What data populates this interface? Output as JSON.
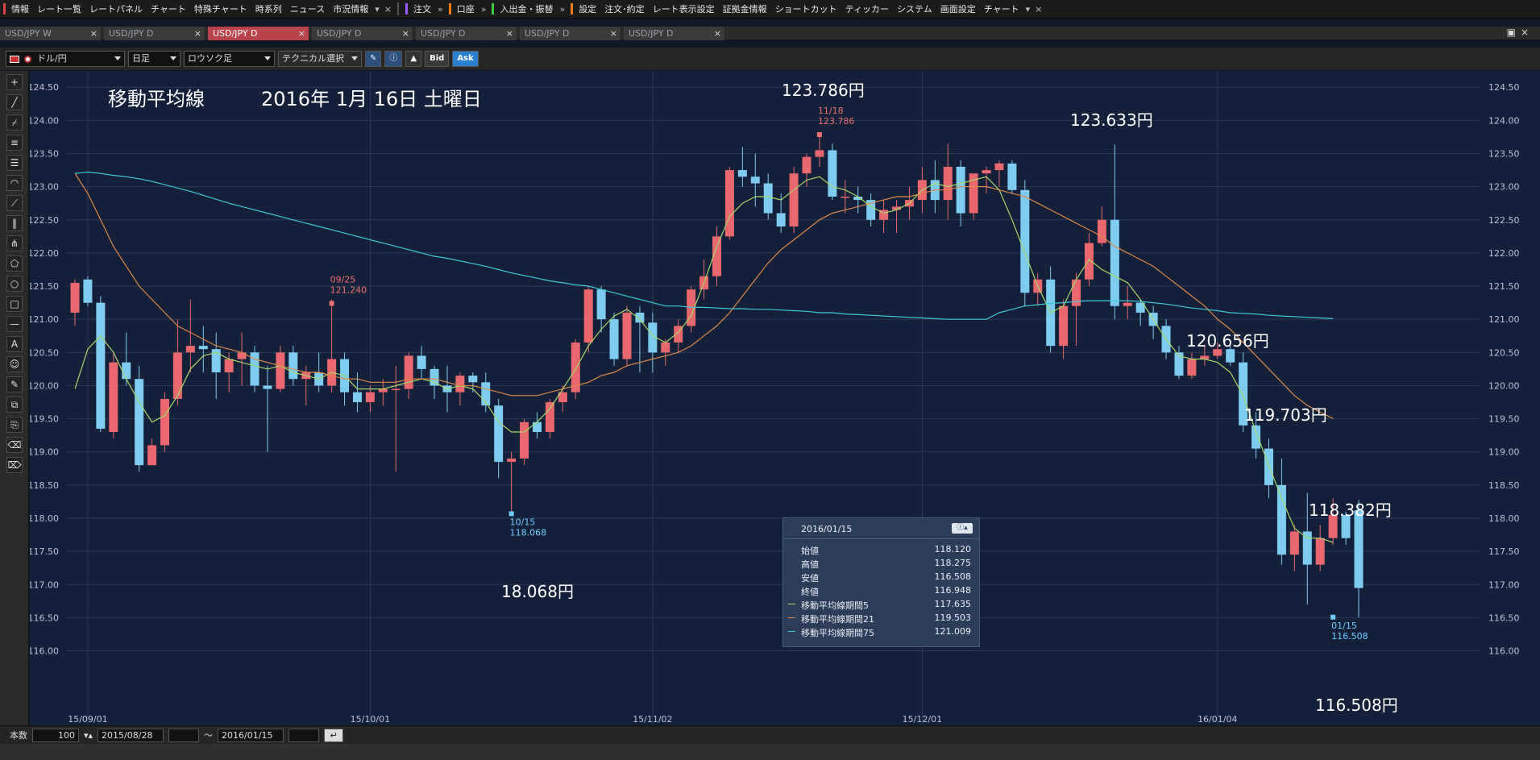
{
  "menubar": {
    "items": [
      "情報",
      "レート一覧",
      "レートパネル",
      "チャート",
      "特殊チャート",
      "時系列",
      "ニュース",
      "市況情報"
    ],
    "order_label": "注文",
    "account_label": "口座",
    "deposit_label": "入出金・振替",
    "settings_label": "設定",
    "right_items": [
      "注文･約定",
      "レート表示設定",
      "証拠金情報",
      "ショートカット",
      "ティッカー",
      "システム",
      "画面設定",
      "チャート"
    ]
  },
  "tabs": [
    "USD/JPY W",
    "USD/JPY D",
    "USD/JPY D",
    "USD/JPY D",
    "USD/JPY D",
    "USD/JPY D",
    "USD/JPY D"
  ],
  "active_tab_index": 2,
  "toolbar": {
    "currency": "ドル/円",
    "period": "日足",
    "chart_style": "ロウソク足",
    "technical": "テクニカル選択",
    "bid_label": "Bid",
    "ask_label": "Ask"
  },
  "bottombar": {
    "count_label": "本数",
    "count_value": "100",
    "start_date": "2015/08/28",
    "range_sep": "～",
    "end_date": "2016/01/15"
  },
  "overlay": {
    "title": "移動平均線",
    "date_text": "2016年 1月 16日 土曜日",
    "annotations": [
      "123.786円",
      "123.633円",
      "120.656円",
      "119.703円",
      "118.382円",
      "18.068円",
      "116.508円"
    ]
  },
  "info_panel": {
    "date": "2016/01/15",
    "rows": [
      {
        "label": "始値",
        "value": "118.120"
      },
      {
        "label": "高値",
        "value": "118.275"
      },
      {
        "label": "安値",
        "value": "116.508"
      },
      {
        "label": "終値",
        "value": "116.948"
      },
      {
        "label": "移動平均線期間5",
        "value": "117.635",
        "color": "#a8d86a"
      },
      {
        "label": "移動平均線期間21",
        "value": "119.503",
        "color": "#e08848"
      },
      {
        "label": "移動平均線期間75",
        "value": "121.009",
        "color": "#3cc8d8"
      }
    ]
  },
  "chart_data": {
    "type": "candlestick",
    "y_ticks": [
      "124.50",
      "124.00",
      "123.50",
      "123.00",
      "122.50",
      "122.00",
      "121.50",
      "121.00",
      "120.50",
      "120.00",
      "119.50",
      "119.00",
      "118.50",
      "118.00",
      "117.50",
      "117.00",
      "116.50",
      "116.00"
    ],
    "ylim": [
      115.8,
      124.6
    ],
    "x_tick_labels": [
      {
        "label": "15/09/01",
        "index": 1
      },
      {
        "label": "15/10/01",
        "index": 23
      },
      {
        "label": "15/11/02",
        "index": 45
      },
      {
        "label": "15/12/01",
        "index": 66
      },
      {
        "label": "16/01/04",
        "index": 89
      }
    ],
    "grid": true,
    "marks": [
      {
        "index": 20,
        "date": "09/25",
        "value": "121.240",
        "price": 121.24,
        "color": "#f07070",
        "pos": "above"
      },
      {
        "index": 34,
        "date": "10/15",
        "value": "118.068",
        "price": 118.068,
        "color": "#6ecfff",
        "pos": "below"
      },
      {
        "index": 58,
        "date": "11/18",
        "value": "123.786",
        "price": 123.786,
        "color": "#f07070",
        "pos": "above"
      },
      {
        "index": 98,
        "date": "01/15",
        "value": "116.508",
        "price": 116.508,
        "color": "#6ecfff",
        "pos": "below"
      }
    ],
    "up_color": "#e8686e",
    "down_color": "#7ecdf0",
    "ohlc": [
      [
        121.1,
        121.6,
        120.9,
        121.55
      ],
      [
        121.6,
        121.65,
        121.2,
        121.25
      ],
      [
        121.25,
        121.35,
        119.3,
        119.35
      ],
      [
        119.3,
        120.5,
        119.2,
        120.35
      ],
      [
        120.35,
        120.8,
        120.0,
        120.1
      ],
      [
        120.1,
        120.3,
        118.7,
        118.8
      ],
      [
        118.8,
        119.2,
        118.8,
        119.1
      ],
      [
        119.1,
        119.9,
        119.0,
        119.8
      ],
      [
        119.8,
        121.0,
        119.7,
        120.5
      ],
      [
        120.5,
        121.3,
        120.2,
        120.6
      ],
      [
        120.6,
        120.9,
        120.2,
        120.55
      ],
      [
        120.55,
        120.8,
        119.8,
        120.2
      ],
      [
        120.2,
        120.5,
        119.9,
        120.4
      ],
      [
        120.4,
        120.8,
        120.0,
        120.5
      ],
      [
        120.5,
        120.6,
        119.9,
        120.0
      ],
      [
        120.0,
        120.3,
        119.0,
        119.95
      ],
      [
        119.95,
        120.6,
        119.9,
        120.5
      ],
      [
        120.5,
        120.6,
        120.0,
        120.1
      ],
      [
        120.1,
        120.3,
        119.7,
        120.2
      ],
      [
        120.2,
        120.5,
        119.9,
        120.0
      ],
      [
        120.0,
        121.3,
        119.9,
        120.4
      ],
      [
        120.4,
        120.5,
        119.7,
        119.9
      ],
      [
        119.9,
        120.2,
        119.6,
        119.75
      ],
      [
        119.75,
        120.0,
        119.6,
        119.9
      ],
      [
        119.9,
        120.1,
        119.7,
        119.95
      ],
      [
        119.95,
        120.3,
        118.7,
        119.95
      ],
      [
        119.95,
        120.5,
        119.8,
        120.45
      ],
      [
        120.45,
        120.6,
        120.1,
        120.25
      ],
      [
        120.25,
        120.3,
        119.8,
        120.0
      ],
      [
        120.0,
        120.3,
        119.6,
        119.9
      ],
      [
        119.9,
        120.2,
        119.7,
        120.15
      ],
      [
        120.15,
        120.2,
        119.9,
        120.05
      ],
      [
        120.05,
        120.2,
        119.6,
        119.7
      ],
      [
        119.7,
        119.8,
        118.6,
        118.85
      ],
      [
        118.85,
        119.0,
        118.068,
        118.9
      ],
      [
        118.9,
        119.5,
        118.8,
        119.45
      ],
      [
        119.45,
        119.6,
        119.2,
        119.3
      ],
      [
        119.3,
        119.8,
        119.2,
        119.75
      ],
      [
        119.75,
        120.0,
        119.6,
        119.9
      ],
      [
        119.9,
        120.7,
        119.8,
        120.65
      ],
      [
        120.65,
        121.5,
        120.5,
        121.45
      ],
      [
        121.45,
        121.5,
        120.8,
        121.0
      ],
      [
        121.0,
        121.1,
        120.3,
        120.4
      ],
      [
        120.4,
        121.2,
        120.3,
        121.1
      ],
      [
        121.1,
        121.2,
        120.2,
        120.95
      ],
      [
        120.95,
        121.1,
        120.2,
        120.5
      ],
      [
        120.5,
        120.7,
        120.3,
        120.65
      ],
      [
        120.65,
        121.0,
        120.5,
        120.9
      ],
      [
        120.9,
        121.5,
        120.8,
        121.45
      ],
      [
        121.45,
        121.9,
        121.3,
        121.65
      ],
      [
        121.65,
        122.4,
        121.5,
        122.25
      ],
      [
        122.25,
        123.3,
        122.2,
        123.25
      ],
      [
        123.25,
        123.6,
        123.0,
        123.15
      ],
      [
        123.15,
        123.5,
        122.7,
        123.05
      ],
      [
        123.05,
        123.2,
        122.5,
        122.6
      ],
      [
        122.6,
        122.9,
        122.3,
        122.4
      ],
      [
        122.4,
        123.3,
        122.3,
        123.2
      ],
      [
        123.2,
        123.5,
        123.0,
        123.45
      ],
      [
        123.45,
        123.786,
        123.3,
        123.55
      ],
      [
        123.55,
        123.65,
        122.8,
        122.85
      ],
      [
        122.85,
        123.1,
        122.6,
        122.85
      ],
      [
        122.85,
        123.0,
        122.6,
        122.8
      ],
      [
        122.8,
        122.9,
        122.4,
        122.5
      ],
      [
        122.5,
        122.8,
        122.3,
        122.65
      ],
      [
        122.65,
        122.8,
        122.3,
        122.7
      ],
      [
        122.7,
        123.0,
        122.5,
        122.8
      ],
      [
        122.8,
        123.3,
        122.6,
        123.1
      ],
      [
        123.1,
        123.4,
        122.6,
        122.8
      ],
      [
        122.8,
        123.65,
        122.5,
        123.3
      ],
      [
        123.3,
        123.4,
        122.4,
        122.6
      ],
      [
        122.6,
        123.2,
        122.5,
        123.2
      ],
      [
        123.2,
        123.3,
        122.9,
        123.25
      ],
      [
        123.25,
        123.4,
        123.0,
        123.35
      ],
      [
        123.35,
        123.4,
        122.9,
        122.95
      ],
      [
        122.95,
        123.1,
        121.2,
        121.4
      ],
      [
        121.4,
        121.7,
        121.2,
        121.6
      ],
      [
        121.6,
        121.8,
        120.5,
        120.6
      ],
      [
        120.6,
        121.3,
        120.4,
        121.2
      ],
      [
        121.2,
        121.7,
        120.6,
        121.6
      ],
      [
        121.6,
        122.3,
        121.5,
        122.15
      ],
      [
        122.15,
        122.7,
        122.1,
        122.5
      ],
      [
        122.5,
        123.633,
        121.0,
        121.2
      ],
      [
        121.2,
        121.5,
        121.0,
        121.25
      ],
      [
        121.25,
        121.3,
        120.9,
        121.1
      ],
      [
        121.1,
        121.2,
        120.7,
        120.9
      ],
      [
        120.9,
        121.0,
        120.4,
        120.5
      ],
      [
        120.5,
        120.6,
        120.1,
        120.15
      ],
      [
        120.15,
        120.5,
        120.1,
        120.4
      ],
      [
        120.4,
        120.6,
        120.3,
        120.45
      ],
      [
        120.45,
        120.656,
        120.4,
        120.55
      ],
      [
        120.55,
        120.6,
        120.3,
        120.35
      ],
      [
        120.35,
        120.5,
        119.3,
        119.4
      ],
      [
        119.4,
        119.6,
        118.9,
        119.05
      ],
      [
        119.05,
        119.2,
        118.3,
        118.5
      ],
      [
        118.5,
        118.9,
        117.3,
        117.45
      ],
      [
        117.45,
        117.9,
        117.2,
        117.8
      ],
      [
        117.8,
        118.382,
        116.7,
        117.3
      ],
      [
        117.3,
        117.9,
        117.2,
        117.7
      ],
      [
        117.7,
        118.3,
        117.6,
        118.05
      ],
      [
        118.05,
        118.1,
        117.6,
        117.7
      ],
      [
        118.12,
        118.275,
        116.508,
        116.948
      ]
    ],
    "series": [
      {
        "period": 5,
        "color": "#a8d86a",
        "start": 0,
        "values": [
          119.95,
          120.55,
          120.75,
          120.5,
          120.1,
          119.75,
          119.45,
          119.55,
          119.85,
          120.25,
          120.45,
          120.5,
          120.4,
          120.35,
          120.3,
          120.25,
          120.3,
          120.2,
          120.15,
          120.1,
          120.2,
          120.15,
          119.95,
          119.95,
          119.95,
          120.0,
          120.05,
          120.1,
          120.05,
          119.95,
          120.0,
          119.95,
          119.75,
          119.45,
          119.3,
          119.3,
          119.45,
          119.65,
          119.95,
          120.25,
          120.6,
          120.85,
          121.05,
          121.15,
          121.0,
          120.75,
          120.65,
          120.8,
          121.05,
          121.55,
          122.1,
          122.55,
          122.75,
          122.85,
          122.85,
          122.8,
          122.95,
          123.1,
          123.15,
          123.0,
          122.95,
          122.85,
          122.7,
          122.6,
          122.65,
          122.75,
          122.95,
          123.05,
          123.0,
          123.05,
          123.1,
          123.15,
          122.95,
          122.5,
          122.0,
          121.5,
          121.1,
          121.2,
          121.6,
          121.9,
          121.75,
          121.65,
          121.55,
          121.3,
          121.0,
          120.7,
          120.45,
          120.4,
          120.4,
          120.35,
          120.2,
          119.85,
          119.3,
          118.8,
          118.3,
          117.85,
          117.7,
          117.7,
          117.635
        ]
      },
      {
        "period": 21,
        "color": "#e08848",
        "start": 0,
        "values": [
          123.2,
          122.9,
          122.5,
          122.1,
          121.8,
          121.5,
          121.3,
          121.1,
          120.9,
          120.8,
          120.7,
          120.6,
          120.55,
          120.5,
          120.4,
          120.35,
          120.3,
          120.25,
          120.2,
          120.2,
          120.15,
          120.1,
          120.1,
          120.05,
          120.05,
          120.05,
          120.1,
          120.1,
          120.1,
          120.05,
          120.0,
          120.0,
          119.95,
          119.9,
          119.85,
          119.85,
          119.85,
          119.9,
          119.95,
          120.0,
          120.05,
          120.15,
          120.2,
          120.3,
          120.35,
          120.4,
          120.45,
          120.5,
          120.6,
          120.75,
          120.9,
          121.1,
          121.35,
          121.6,
          121.85,
          122.05,
          122.2,
          122.35,
          122.5,
          122.6,
          122.65,
          122.7,
          122.75,
          122.8,
          122.85,
          122.85,
          122.9,
          122.95,
          122.95,
          123.0,
          123.0,
          123.0,
          122.95,
          122.9,
          122.85,
          122.75,
          122.65,
          122.55,
          122.45,
          122.35,
          122.25,
          122.1,
          122.0,
          121.9,
          121.8,
          121.65,
          121.5,
          121.35,
          121.2,
          121.0,
          120.85,
          120.65,
          120.45,
          120.25,
          120.05,
          119.85,
          119.7,
          119.6,
          119.503
        ]
      },
      {
        "period": 75,
        "color": "#3cc8d8",
        "start": 0,
        "values": [
          123.2,
          123.22,
          123.2,
          123.17,
          123.15,
          123.12,
          123.08,
          123.03,
          122.98,
          122.93,
          122.87,
          122.81,
          122.75,
          122.7,
          122.65,
          122.6,
          122.55,
          122.5,
          122.45,
          122.4,
          122.35,
          122.3,
          122.25,
          122.2,
          122.15,
          122.1,
          122.05,
          122.0,
          121.95,
          121.92,
          121.88,
          121.84,
          121.8,
          121.75,
          121.7,
          121.66,
          121.62,
          121.58,
          121.55,
          121.52,
          121.5,
          121.45,
          121.4,
          121.35,
          121.3,
          121.25,
          121.2,
          121.2,
          121.18,
          121.18,
          121.17,
          121.16,
          121.16,
          121.15,
          121.15,
          121.14,
          121.13,
          121.12,
          121.1,
          121.1,
          121.08,
          121.07,
          121.06,
          121.05,
          121.04,
          121.03,
          121.02,
          121.01,
          121.0,
          121.0,
          121.0,
          121.0,
          121.1,
          121.15,
          121.2,
          121.22,
          121.24,
          121.25,
          121.27,
          121.28,
          121.28,
          121.28,
          121.28,
          121.27,
          121.25,
          121.23,
          121.2,
          121.17,
          121.15,
          121.13,
          121.1,
          121.09,
          121.08,
          121.06,
          121.05,
          121.04,
          121.03,
          121.02,
          121.009
        ]
      }
    ]
  }
}
